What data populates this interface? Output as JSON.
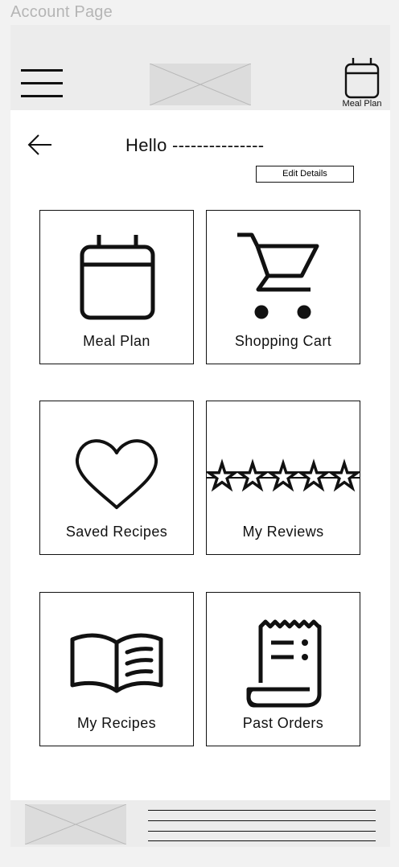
{
  "page_label": "Account Page",
  "header": {
    "menu_icon": "hamburger-icon",
    "logo_placeholder": "image-placeholder",
    "meal_plan_label": "Meal Plan",
    "meal_plan_icon": "calendar-icon"
  },
  "greeting": "Hello ---------------",
  "edit_details_label": "Edit Details",
  "tiles": [
    {
      "label": "Meal Plan",
      "icon": "calendar-icon"
    },
    {
      "label": "Shopping Cart",
      "icon": "shopping-cart-icon"
    },
    {
      "label": "Saved Recipes",
      "icon": "heart-icon"
    },
    {
      "label": "My Reviews",
      "icon": "five-stars-icon"
    },
    {
      "label": "My Recipes",
      "icon": "open-book-icon"
    },
    {
      "label": "Past Orders",
      "icon": "receipt-icon"
    }
  ],
  "footer": {
    "image_placeholder": "image-placeholder",
    "text_lines": 4
  }
}
